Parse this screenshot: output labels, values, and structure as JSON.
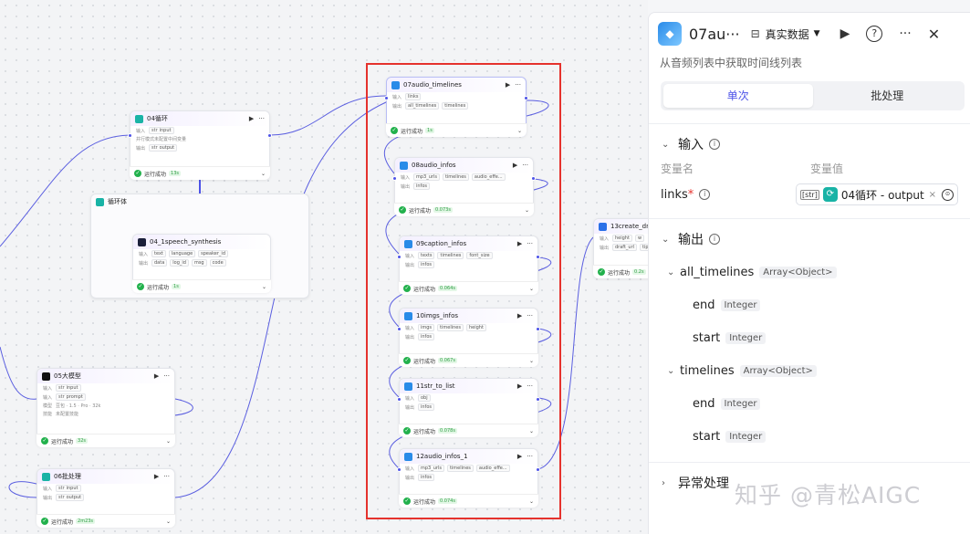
{
  "nodes": {
    "loop04": {
      "title": "04循环",
      "r1_label": "输入",
      "r1_tag": "input",
      "r2_label": "并行模式",
      "r2_text": "未配置中间变量",
      "r3_label": "输出",
      "r3_tag": "output",
      "status": "运行成功",
      "duration": "13s"
    },
    "loopbody": {
      "title": "循环体"
    },
    "speech": {
      "title": "04_1speech_synthesis",
      "r1_label": "输入",
      "r1_tags": [
        "text",
        "language",
        "speaker_id"
      ],
      "r2_label": "输出",
      "r2_tags": [
        "data",
        "log_id",
        "msg",
        "code"
      ],
      "status": "运行成功",
      "duration": "1s"
    },
    "llm05": {
      "title": "05大模型",
      "r1_label": "输入",
      "r1_tag": "input",
      "r2_label": "输入",
      "r2_tag": "prompt",
      "r3_label": "模型",
      "r3_text": "豆包 · 1.5 · Pro · 32k",
      "r4_label": "技能",
      "r4_text": "未配置技能",
      "status": "运行成功",
      "duration": "32s"
    },
    "batch06": {
      "title": "06批处理",
      "r1_label": "输入",
      "r1_tag": "input",
      "r2_label": "输出",
      "r2_tag": "output",
      "status": "运行成功",
      "duration": "2m23s"
    },
    "n07": {
      "title": "07audio_timelines",
      "r1_label": "输入",
      "r1_tags": [
        "links"
      ],
      "r2_label": "输出",
      "r2_tags": [
        "all_timelines",
        "timelines"
      ],
      "status": "运行成功",
      "duration": "1s"
    },
    "n08": {
      "title": "08audio_infos",
      "r1_label": "输入",
      "r1_tags": [
        "mp3_urls",
        "timelines",
        "audio_effe..."
      ],
      "r2_label": "输出",
      "r2_tags": [
        "infos"
      ],
      "status": "运行成功",
      "duration": "0.073s"
    },
    "n09": {
      "title": "09caption_infos",
      "r1_label": "输入",
      "r1_tags": [
        "texts",
        "timelines",
        "font_size"
      ],
      "r2_label": "输出",
      "r2_tags": [
        "infos"
      ],
      "status": "运行成功",
      "duration": "0.064s"
    },
    "n10": {
      "title": "10imgs_infos",
      "r1_label": "输入",
      "r1_tags": [
        "imgs",
        "timelines",
        "height"
      ],
      "r2_label": "输出",
      "r2_tags": [
        "infos"
      ],
      "status": "运行成功",
      "duration": "0.067s"
    },
    "n11": {
      "title": "11str_to_list",
      "r1_label": "输入",
      "r1_tags": [
        "obj"
      ],
      "r2_label": "输出",
      "r2_tags": [
        "infos"
      ],
      "status": "运行成功",
      "duration": "0.078s"
    },
    "n12": {
      "title": "12audio_infos_1",
      "r1_label": "输入",
      "r1_tags": [
        "mp3_urls",
        "timelines",
        "audio_effe..."
      ],
      "r2_label": "输出",
      "r2_tags": [
        "infos"
      ],
      "status": "运行成功",
      "duration": "0.074s"
    },
    "n13": {
      "title": "13create_dr",
      "r1_label": "输入",
      "r1_tags": [
        "height",
        "w"
      ],
      "r2_label": "输出",
      "r2_tags": [
        "draft_url",
        "tip"
      ],
      "status": "运行成功",
      "duration": "0.2s"
    }
  },
  "panel": {
    "title": "07au···",
    "mode_label": "真实数据",
    "description": "从音频列表中获取时间线列表",
    "tabs": [
      "单次",
      "批处理"
    ],
    "input_section": "输入",
    "col_name": "变量名",
    "col_value": "变量值",
    "input_var": "links",
    "input_required": "*",
    "input_ref": "04循环 - output",
    "output_section": "输出",
    "outputs": [
      {
        "name": "all_timelines",
        "type": "Array<Object>",
        "children": [
          {
            "name": "end",
            "type": "Integer"
          },
          {
            "name": "start",
            "type": "Integer"
          }
        ]
      },
      {
        "name": "timelines",
        "type": "Array<Object>",
        "children": [
          {
            "name": "end",
            "type": "Integer"
          },
          {
            "name": "start",
            "type": "Integer"
          }
        ]
      }
    ],
    "exception_section": "异常处理"
  },
  "watermark": "知乎 @青松AIGC",
  "colors": {
    "accent": "#4d53e8",
    "success": "#22b14c",
    "highlight": "#e5322d"
  }
}
